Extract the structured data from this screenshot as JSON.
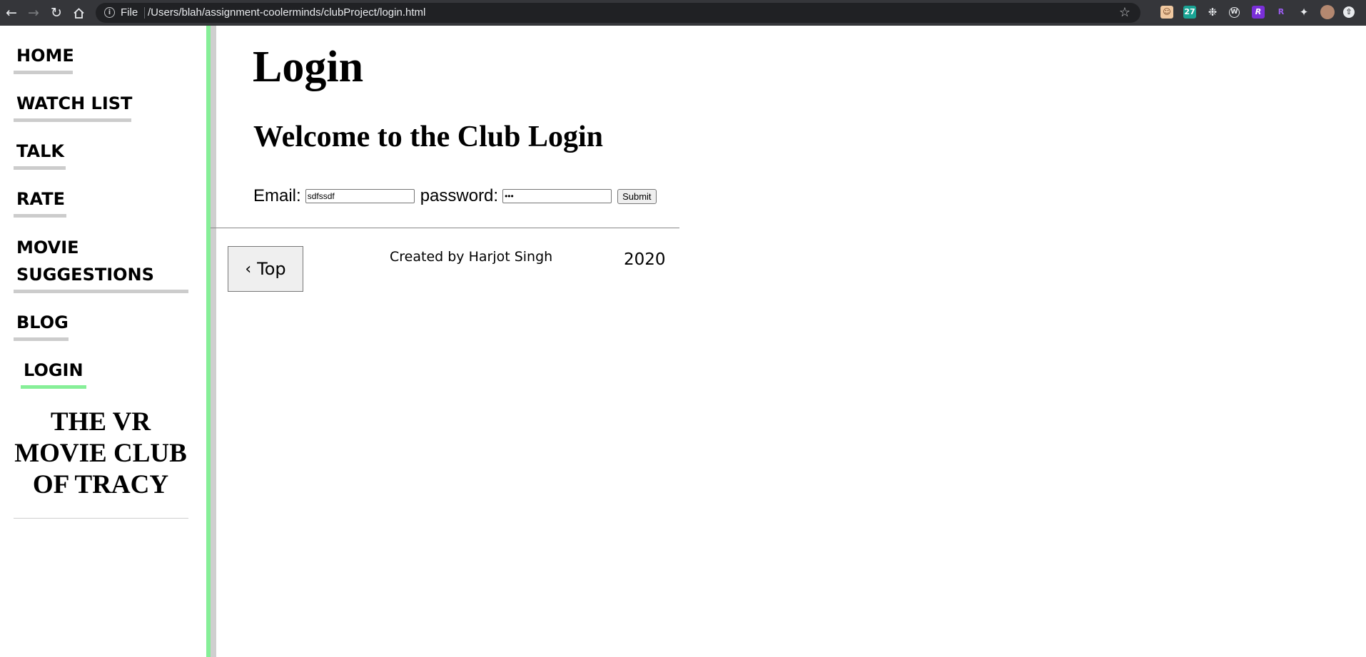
{
  "browser": {
    "back_icon": "arrow-left",
    "forward_icon": "arrow-right",
    "reload_icon": "reload",
    "home_icon": "home",
    "scheme_label": "File",
    "url": "/Users/blah/assignment-coolerminds/clubProject/login.html",
    "extensions": [
      "27",
      "R",
      "R"
    ]
  },
  "sidebar": {
    "items": [
      {
        "label": "HOME"
      },
      {
        "label": "WATCH LIST"
      },
      {
        "label": "TALK"
      },
      {
        "label": "RATE"
      },
      {
        "label": "MOVIE"
      },
      {
        "label": "SUGGESTIONS"
      },
      {
        "label": "BLOG"
      },
      {
        "label": "LOGIN",
        "active": true
      }
    ],
    "club_title_lines": [
      "THE VR",
      "MOVIE CLUB",
      "OF TRACY"
    ]
  },
  "main": {
    "title": "Login",
    "welcome": "Welcome to the Club Login",
    "form": {
      "email_label": "Email:",
      "email_value": "sdfssdf",
      "password_label": "password:",
      "password_value": "•••",
      "submit_label": "Submit"
    }
  },
  "footer": {
    "top_button_label": "Top",
    "credit": "Created by Harjot Singh",
    "year": "2020"
  },
  "colors": {
    "accent_green": "#86ef98",
    "underline_grey": "#cccccc",
    "chrome_bg": "#35363a"
  }
}
